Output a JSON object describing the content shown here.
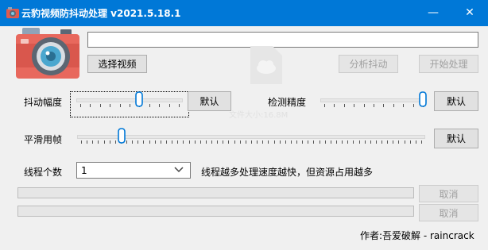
{
  "window": {
    "title": "云豹视频防抖动处理 v2021.5.18.1",
    "controls": {
      "minimize": "—",
      "maximize": "☐",
      "close": "✕"
    }
  },
  "file": {
    "path_value": "",
    "select_button": "选择视频",
    "analyze_button": "分析抖动",
    "start_button": "开始处理"
  },
  "shake_amplitude": {
    "label": "抖动幅度",
    "default_button": "默认",
    "level": 0.6
  },
  "detect_precision": {
    "label": "检测精度",
    "default_button": "默认",
    "level": 1.0
  },
  "smooth_frames": {
    "label": "平滑用帧",
    "default_button": "默认",
    "level": 0.12
  },
  "threads": {
    "label": "线程个数",
    "value": "1",
    "note": "线程越多处理速度越快，但资源占用越多"
  },
  "progress": {
    "bar1_cancel": "取消",
    "bar2_cancel": "取消"
  },
  "watermark": {
    "text": "文件大小:16.8M"
  },
  "footer": {
    "author_text": "作者:吾爱破解  -  raincrack"
  },
  "colors": {
    "titlebar": "#0078d7",
    "slider_thumb": "#0078d7",
    "window_bg": "#f0f0f0"
  },
  "icons": [
    "camera-icon",
    "cloud-file-icon",
    "chevron-down-icon"
  ]
}
